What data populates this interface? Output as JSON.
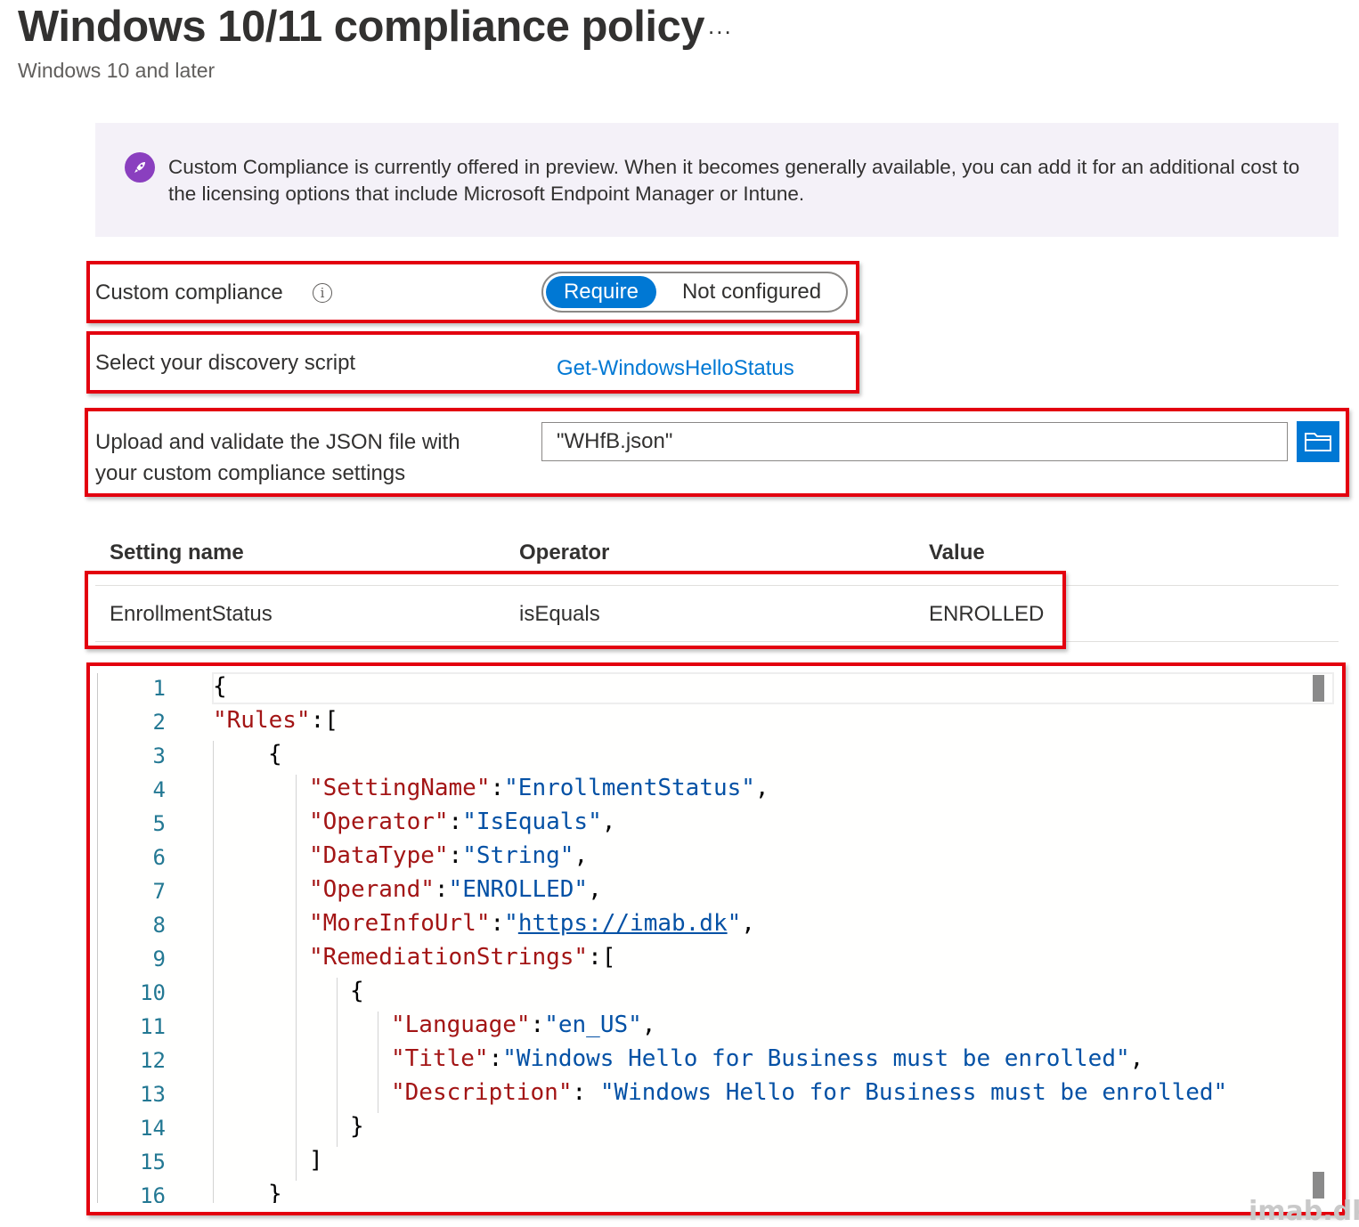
{
  "header": {
    "title": "Windows 10/11 compliance policy",
    "more_label": "...",
    "subtitle": "Windows 10 and later"
  },
  "banner": {
    "icon": "rocket-icon",
    "text": "Custom Compliance is currently offered in preview. When it becomes generally available, you can add it for an additional cost to the licensing options that include Microsoft Endpoint Manager or Intune."
  },
  "custom_compliance": {
    "label": "Custom compliance",
    "info_icon": "i",
    "options": [
      "Require",
      "Not configured"
    ],
    "selected": "Require"
  },
  "discovery_script": {
    "label": "Select your discovery script",
    "value": "Get-WindowsHelloStatus"
  },
  "json_upload": {
    "label_line1": "Upload and validate the JSON file with",
    "label_line2": "your custom compliance settings",
    "value": "\"WHfB.json\"",
    "browse_icon": "folder-icon"
  },
  "settings_table": {
    "columns": [
      "Setting name",
      "Operator",
      "Value"
    ],
    "rows": [
      [
        "EnrollmentStatus",
        "isEquals",
        "ENROLLED"
      ]
    ]
  },
  "editor": {
    "line_numbers": [
      "1",
      "2",
      "3",
      "4",
      "5",
      "6",
      "7",
      "8",
      "9",
      "10",
      "11",
      "12",
      "13",
      "14",
      "15",
      "16"
    ],
    "lines": {
      "l1": "{",
      "l2_key": "\"Rules\"",
      "l2_rest": ":[",
      "l3": "{",
      "l4_key": "\"SettingName\"",
      "l4_sep": ":",
      "l4_val": "\"EnrollmentStatus\"",
      "l4_end": ",",
      "l5_key": "\"Operator\"",
      "l5_sep": ":",
      "l5_val": "\"IsEquals\"",
      "l5_end": ",",
      "l6_key": "\"DataType\"",
      "l6_sep": ":",
      "l6_val": "\"String\"",
      "l6_end": ",",
      "l7_key": "\"Operand\"",
      "l7_sep": ":",
      "l7_val": "\"ENROLLED\"",
      "l7_end": ",",
      "l8_key": "\"MoreInfoUrl\"",
      "l8_sep": ":",
      "l8_q1": "\"",
      "l8_url": "https://imab.dk",
      "l8_q2": "\"",
      "l8_end": ",",
      "l9_key": "\"RemediationStrings\"",
      "l9_rest": ":[",
      "l10": "{",
      "l11_key": "\"Language\"",
      "l11_sep": ":",
      "l11_val": "\"en_US\"",
      "l11_end": ",",
      "l12_key": "\"Title\"",
      "l12_sep": ":",
      "l12_val": "\"Windows Hello for Business must be enrolled\"",
      "l12_end": ",",
      "l13_key": "\"Description\"",
      "l13_sep": ": ",
      "l13_val": "\"Windows Hello for Business must be enrolled\"",
      "l14": "}",
      "l15": "]",
      "l16": "}"
    }
  },
  "watermark": "imab.dk",
  "colors": {
    "accent": "#0078d4",
    "highlight_border": "#e3000f",
    "json_key": "#a31515",
    "json_value": "#0451a5",
    "banner_bg": "#f4f1f8",
    "banner_icon": "#8a3fbf"
  }
}
